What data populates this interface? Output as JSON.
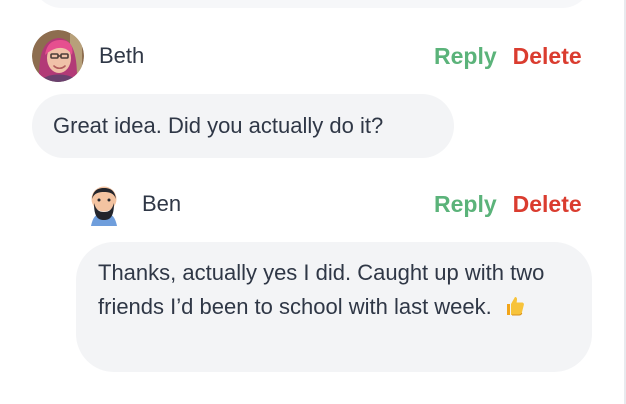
{
  "comments": {
    "beth": {
      "author": "Beth",
      "reply_label": "Reply",
      "delete_label": "Delete",
      "text": "Great idea. Did you actually do it?"
    },
    "ben": {
      "author": "Ben",
      "reply_label": "Reply",
      "delete_label": "Delete",
      "text": "Thanks, actually yes I did. Caught up with two friends I’d been to school with last week."
    }
  },
  "colors": {
    "reply": "#5bb37a",
    "delete": "#da3c2f",
    "bubble": "#f3f4f6",
    "text": "#2f3746"
  },
  "icons": {
    "beth_avatar": "beth-avatar",
    "ben_avatar": "ben-avatar",
    "thumbs_up": "thumbs-up-icon"
  }
}
